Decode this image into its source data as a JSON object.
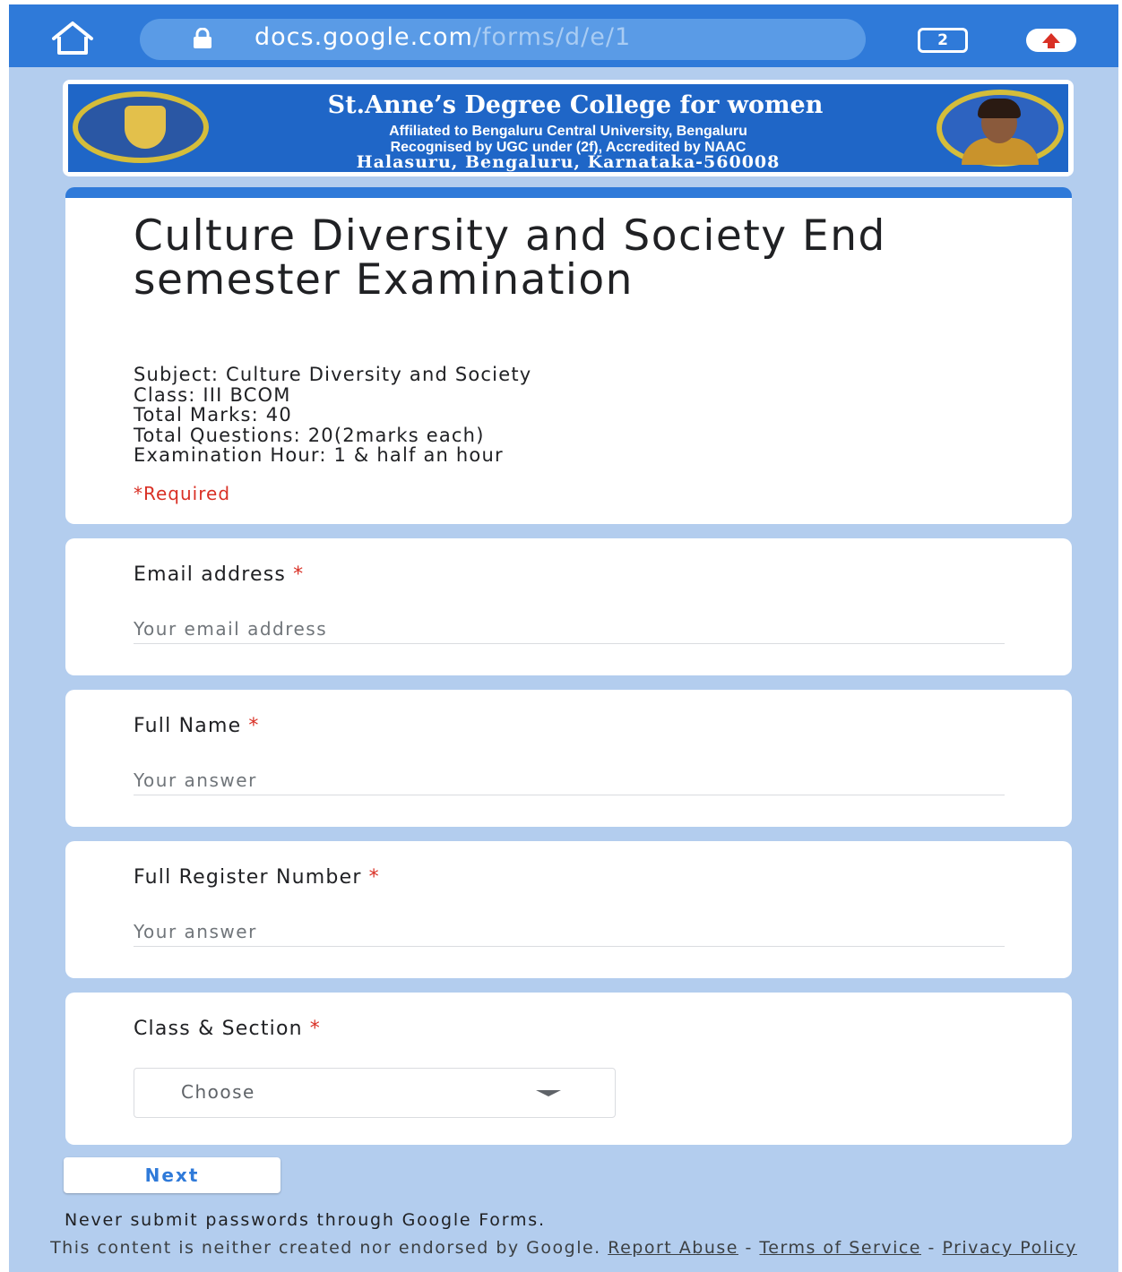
{
  "browser": {
    "url_host": "docs.google.com",
    "url_path": "/forms/d/e/1",
    "tab_count": "2"
  },
  "banner": {
    "college_name": "St.Anne’s Degree College for women",
    "affiliation": "Affiliated to Bengaluru Central University, Bengaluru",
    "recognition": "Recognised by UGC under (2f), Accredited by NAAC",
    "address": "Halasuru, Bengaluru, Karnataka-560008"
  },
  "form": {
    "title": "Culture Diversity and Society End semester Examination",
    "description": [
      "Subject: Culture Diversity and Society",
      "Class: III BCOM",
      "Total Marks: 40",
      "Total Questions: 20(2marks each)",
      "Examination Hour: 1 & half an hour"
    ],
    "required_note": "*Required"
  },
  "questions": [
    {
      "label": "Email address",
      "required_mark": "*",
      "placeholder": "Your email address"
    },
    {
      "label": "Full Name",
      "required_mark": "*",
      "placeholder": "Your answer"
    },
    {
      "label": "Full Register Number",
      "required_mark": "*",
      "placeholder": "Your answer"
    },
    {
      "label": "Class & Section",
      "required_mark": "*",
      "select_value": "Choose"
    }
  ],
  "actions": {
    "next_label": "Next"
  },
  "footer": {
    "never_submit": "Never submit passwords through Google Forms.",
    "disclaimer": "This content is neither created nor endorsed by Google.",
    "report_abuse": "Report Abuse",
    "separator": "-",
    "terms": "Terms of Service",
    "privacy": "Privacy Policy"
  },
  "colors": {
    "browser_bar": "#2f7ad9",
    "page_background": "#b3cdee",
    "accent": "#2f7ad9",
    "required": "#d93025"
  },
  "icons": [
    "home-icon",
    "lock-icon",
    "tab-switcher-icon",
    "update-arrow-icon",
    "college-logo",
    "portrait-image",
    "dropdown-caret-icon"
  ]
}
